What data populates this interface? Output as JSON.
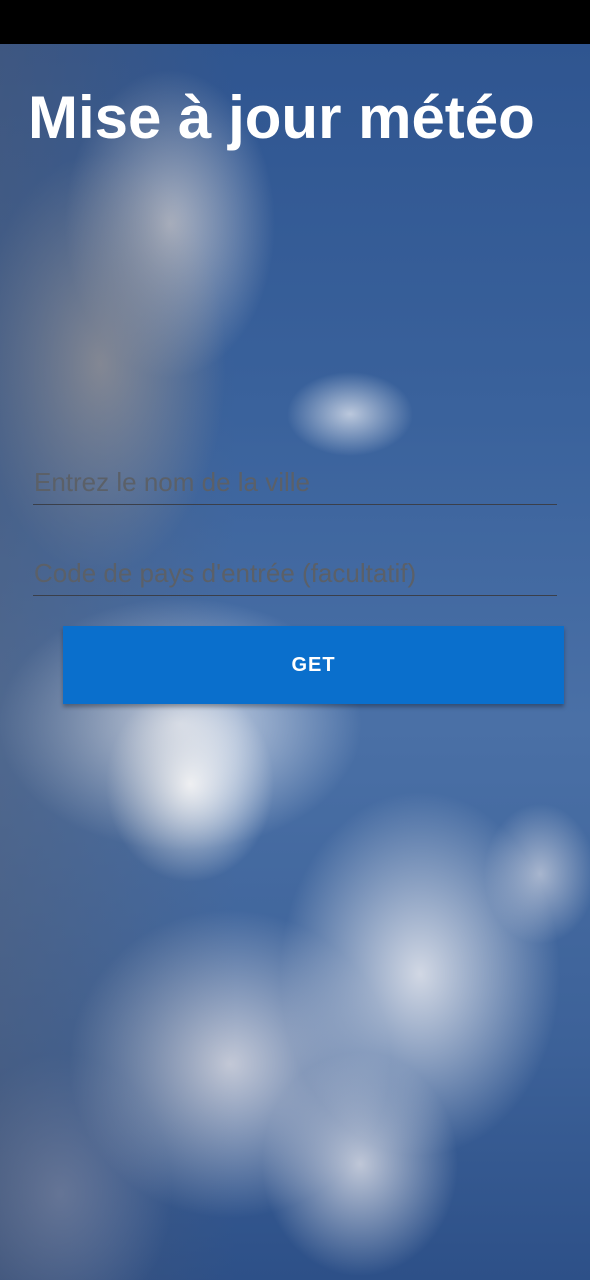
{
  "header": {
    "title": "Mise à jour météo"
  },
  "form": {
    "city_placeholder": "Entrez le nom de la ville",
    "country_placeholder": "Code de pays d'entrée (facultatif)",
    "submit_label": "GET"
  },
  "colors": {
    "button": "#0a6fcc",
    "title_text": "#ffffff",
    "status_bar": "#000000"
  }
}
